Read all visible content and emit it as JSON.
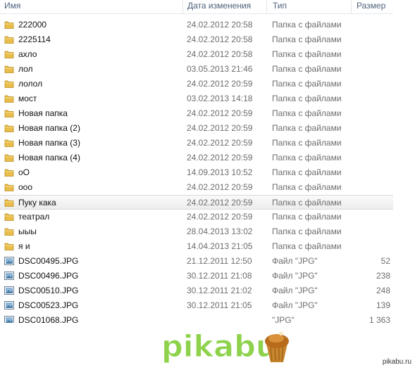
{
  "columns": {
    "name": "Имя",
    "date": "Дата изменения",
    "type": "Тип",
    "size": "Размер"
  },
  "rows": [
    {
      "kind": "folder",
      "name": "222000",
      "date": "24.02.2012 20:58",
      "type": "Папка с файлами",
      "size": ""
    },
    {
      "kind": "folder",
      "name": "2225114",
      "date": "24.02.2012 20:58",
      "type": "Папка с файлами",
      "size": ""
    },
    {
      "kind": "folder",
      "name": "ахло",
      "date": "24.02.2012 20:58",
      "type": "Папка с файлами",
      "size": ""
    },
    {
      "kind": "folder",
      "name": "лол",
      "date": "03.05.2013 21:46",
      "type": "Папка с файлами",
      "size": ""
    },
    {
      "kind": "folder",
      "name": "лолол",
      "date": "24.02.2012 20:59",
      "type": "Папка с файлами",
      "size": ""
    },
    {
      "kind": "folder",
      "name": "мост",
      "date": "03.02.2013 14:18",
      "type": "Папка с файлами",
      "size": ""
    },
    {
      "kind": "folder",
      "name": "Новая папка",
      "date": "24.02.2012 20:59",
      "type": "Папка с файлами",
      "size": ""
    },
    {
      "kind": "folder",
      "name": "Новая папка (2)",
      "date": "24.02.2012 20:59",
      "type": "Папка с файлами",
      "size": ""
    },
    {
      "kind": "folder",
      "name": "Новая папка (3)",
      "date": "24.02.2012 20:59",
      "type": "Папка с файлами",
      "size": ""
    },
    {
      "kind": "folder",
      "name": "Новая папка (4)",
      "date": "24.02.2012 20:59",
      "type": "Папка с файлами",
      "size": ""
    },
    {
      "kind": "folder",
      "name": "оО",
      "date": "14.09.2013 10:52",
      "type": "Папка с файлами",
      "size": ""
    },
    {
      "kind": "folder",
      "name": "ооо",
      "date": "24.02.2012 20:59",
      "type": "Папка с файлами",
      "size": ""
    },
    {
      "kind": "folder",
      "name": "Пуку кака",
      "date": "24.02.2012 20:59",
      "type": "Папка с файлами",
      "size": "",
      "selected": true
    },
    {
      "kind": "folder",
      "name": "театрал",
      "date": "24.02.2012 20:59",
      "type": "Папка с файлами",
      "size": ""
    },
    {
      "kind": "folder",
      "name": "ыыы",
      "date": "28.04.2013 13:02",
      "type": "Папка с файлами",
      "size": ""
    },
    {
      "kind": "folder",
      "name": "я и",
      "date": "14.04.2013 21:05",
      "type": "Папка с файлами",
      "size": ""
    },
    {
      "kind": "image",
      "name": "DSC00495.JPG",
      "date": "21.12.2011 12:50",
      "type": "Файл \"JPG\"",
      "size": "52"
    },
    {
      "kind": "image",
      "name": "DSC00496.JPG",
      "date": "30.12.2011 21:08",
      "type": "Файл \"JPG\"",
      "size": "238"
    },
    {
      "kind": "image",
      "name": "DSC00510.JPG",
      "date": "30.12.2011 21:02",
      "type": "Файл \"JPG\"",
      "size": "248"
    },
    {
      "kind": "image",
      "name": "DSC00523.JPG",
      "date": "30.12.2011 21:05",
      "type": "Файл \"JPG\"",
      "size": "139"
    },
    {
      "kind": "image",
      "name": "DSC01068.JPG",
      "date": "",
      "type": "\"JPG\"",
      "size": "1 363"
    }
  ],
  "logo": {
    "text": "pikabu",
    "icon": "cupcake-icon",
    "text_color": "#8ed24c"
  },
  "watermark": "pikabu.ru"
}
